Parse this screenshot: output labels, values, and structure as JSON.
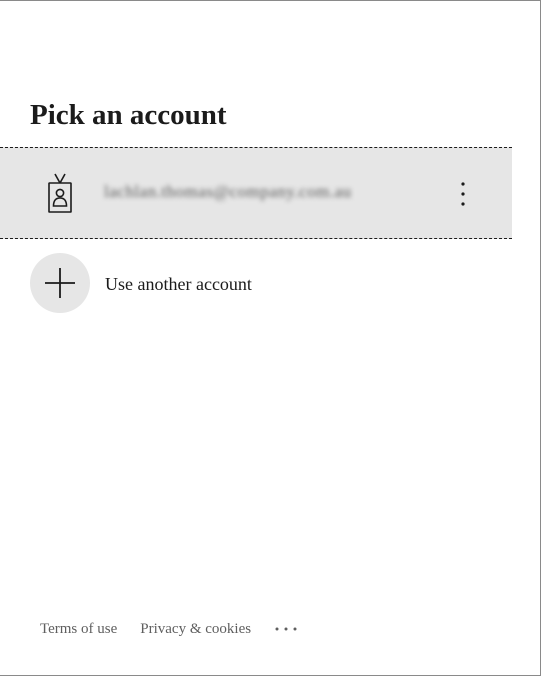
{
  "header": {
    "title": "Pick an account"
  },
  "accounts": [
    {
      "email": "lachlan.thomas@company.com.au",
      "icon": "id-badge-icon",
      "more_icon": "vertical-ellipsis-icon"
    }
  ],
  "other_account": {
    "label": "Use another account",
    "icon": "plus-icon"
  },
  "footer": {
    "terms_label": "Terms of use",
    "privacy_label": "Privacy & cookies",
    "more_icon": "horizontal-ellipsis-icon"
  },
  "colors": {
    "tile_background": "#e6e6e6",
    "text_primary": "#1b1b1b",
    "text_secondary": "#5f5f5f"
  }
}
